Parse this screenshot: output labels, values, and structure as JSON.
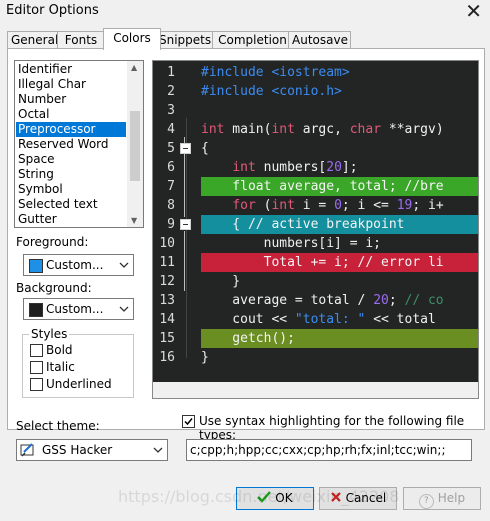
{
  "window": {
    "title": "Editor Options",
    "close_glyph": "✕"
  },
  "tabs": [
    "General",
    "Fonts",
    "Colors",
    "Snippets",
    "Completion",
    "Autosave"
  ],
  "element_list": {
    "items": [
      "Identifier",
      "Illegal Char",
      "Number",
      "Octal",
      "Preprocessor",
      "Reserved Word",
      "Space",
      "String",
      "Symbol",
      "Selected text",
      "Gutter"
    ],
    "selected": "Preprocessor"
  },
  "foreground": {
    "label": "Foreground:",
    "value": "Custom...",
    "color": "#1e90e6"
  },
  "background": {
    "label": "Background:",
    "value": "Custom...",
    "color": "#1e1e1e"
  },
  "styles": {
    "title": "Styles",
    "bold": "Bold",
    "italic": "Italic",
    "underlined": "Underlined"
  },
  "editor": {
    "colors": {
      "bg": "#232525",
      "preprocessor": "#3c8cf0",
      "keyword": "#e05a78",
      "number": "#9b6bf0",
      "selected": "#3aa728",
      "breakpoint": "#138f9e",
      "error": "#c8213a",
      "active": "#6b8e23"
    },
    "line_numbers": [
      "1",
      "2",
      "3",
      "4",
      "5",
      "6",
      "7",
      "8",
      "9",
      "10",
      "11",
      "12",
      "13",
      "14",
      "15",
      "16"
    ]
  },
  "theme": {
    "label": "Select theme:",
    "value": "GSS Hacker"
  },
  "syntax": {
    "label": "Use syntax highlighting for the following file types:",
    "file_types": "c;cpp;h;hpp;cc;cxx;cp;hp;rh;fx;inl;tcc;win;;"
  },
  "buttons": {
    "ok": "OK",
    "cancel": "Cancel",
    "help": "Help"
  },
  "watermark": "https://blog.csdn.net/weixin_42208"
}
